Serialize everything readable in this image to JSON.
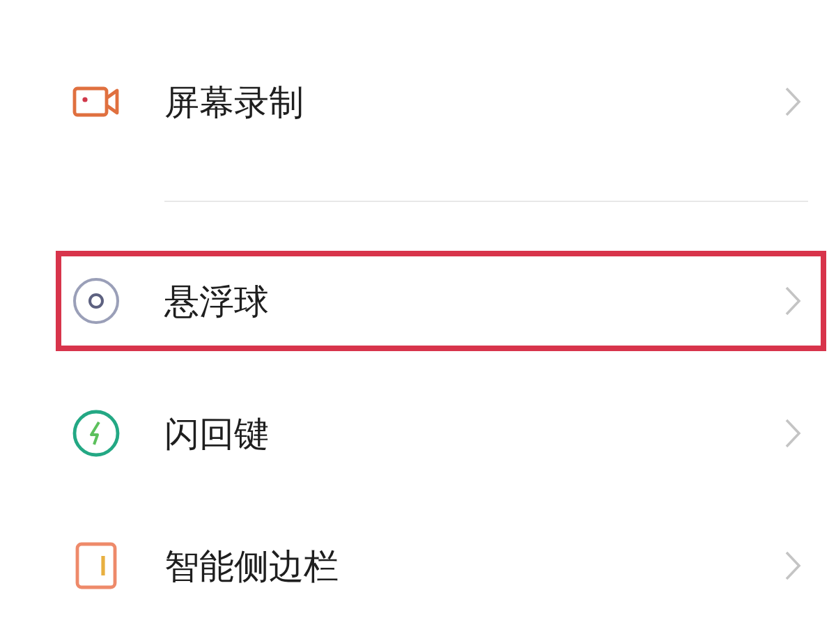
{
  "groups": [
    {
      "items": [
        {
          "kind": "camera",
          "label": "屏幕录制",
          "highlighted": false
        }
      ]
    },
    {
      "items": [
        {
          "kind": "ring",
          "label": "悬浮球",
          "highlighted": true
        },
        {
          "kind": "bolt",
          "label": "闪回键",
          "highlighted": false
        },
        {
          "kind": "sidebar",
          "label": "智能侧边栏",
          "highlighted": false
        }
      ]
    }
  ]
}
